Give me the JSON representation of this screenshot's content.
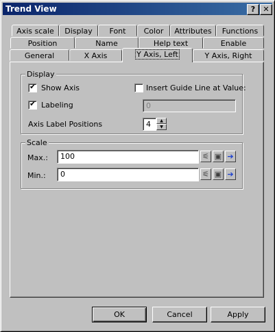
{
  "window": {
    "title": "Trend View",
    "help_label": "?",
    "close_label": "✕"
  },
  "tabs": {
    "row1": [
      "Axis scale",
      "Display",
      "Font",
      "Color",
      "Attributes",
      "Functions"
    ],
    "row2": [
      "Position",
      "Name",
      "Help text",
      "Enable"
    ],
    "row3": [
      "General",
      "X Axis",
      "Y Axis, Left",
      "Y Axis, Right"
    ],
    "active": "Y Axis, Left"
  },
  "display_group": {
    "label": "Display",
    "show_axis": {
      "label": "Show Axis",
      "checked": true
    },
    "labeling": {
      "label": "Labeling",
      "checked": true
    },
    "insert_guide": {
      "label": "Insert Guide Line at Value:",
      "checked": false
    },
    "guide_value": "0",
    "axis_label_positions_label": "Axis Label Positions",
    "axis_label_positions_value": "4"
  },
  "scale_group": {
    "label": "Scale",
    "max_label": "Max.:",
    "max_value": "100",
    "min_label": "Min.:",
    "min_value": "0"
  },
  "buttons": {
    "ok": "OK",
    "cancel": "Cancel",
    "apply": "Apply"
  },
  "icons": [
    "tag-icon",
    "variable-icon",
    "arrow-right-icon"
  ],
  "colors": {
    "title_bar": "#0a246a",
    "face": "#c0c0c0",
    "arrow_icon": "#1a3fd0"
  }
}
